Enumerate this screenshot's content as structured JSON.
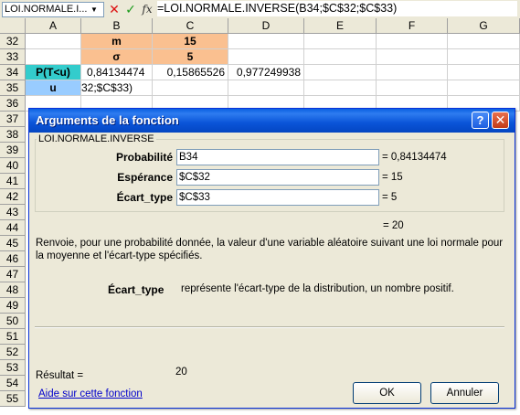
{
  "formula_bar": {
    "name_box": "LOI.NORMALE.I...",
    "formula": "=LOI.NORMALE.INVERSE(B34;$C$32;$C$33)"
  },
  "columns": [
    "A",
    "B",
    "C",
    "D",
    "E",
    "F",
    "G"
  ],
  "rows": [
    "32",
    "33",
    "34",
    "35",
    "36",
    "37",
    "38",
    "39",
    "40",
    "41",
    "42",
    "43",
    "44",
    "45",
    "46",
    "47",
    "48",
    "49",
    "50",
    "51",
    "52",
    "53",
    "54",
    "55"
  ],
  "cells": {
    "b32": "m",
    "c32": "15",
    "b33": "σ",
    "c33": "5",
    "a34": "P(T<u)",
    "b34": "0,84134474",
    "c34": "0,15865526",
    "d34": "0,977249938",
    "a35": "u",
    "b35": "32;$C$33)"
  },
  "colors": {
    "orange": "#fac090",
    "teal": "#33cccc",
    "light_blue": "#99ccff",
    "dialog_title_blue": "#0a54d8"
  },
  "dialog": {
    "title": "Arguments de la fonction",
    "function_name": "LOI.NORMALE.INVERSE",
    "arguments": [
      {
        "label": "Probabilité",
        "value": "B34",
        "result": "= 0,84134474"
      },
      {
        "label": "Espérance",
        "value": "$C$32",
        "result": "= 15"
      },
      {
        "label": "Écart_type",
        "value": "$C$33",
        "result": "= 5"
      }
    ],
    "total_result": "= 20",
    "description": "Renvoie, pour une probabilité donnée, la valeur d'une variable aléatoire suivant une loi normale pour la moyenne et l'écart-type spécifiés.",
    "param_name": "Écart_type",
    "param_description": "représente l'écart-type de la distribution, un nombre positif.",
    "result_label": "Résultat =",
    "result_value": "20",
    "help_link": "Aide sur cette fonction",
    "ok_label": "OK",
    "cancel_label": "Annuler",
    "help_button": "?",
    "close_button": "✕"
  }
}
